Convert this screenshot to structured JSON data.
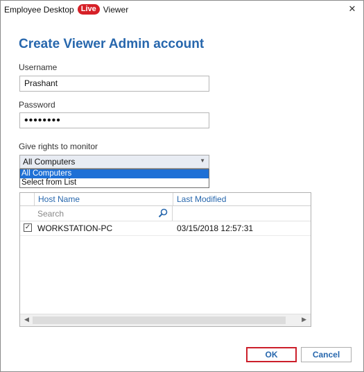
{
  "window": {
    "title_prefix": "Employee Desktop",
    "title_badge": "Live",
    "title_suffix": "Viewer",
    "close_glyph": "✕"
  },
  "form": {
    "heading": "Create Viewer Admin account",
    "username_label": "Username",
    "username_value": "Prashant",
    "password_label": "Password",
    "password_value": "••••••••",
    "rights_label": "Give rights to monitor",
    "rights_selected": "All Computers",
    "rights_options": [
      "All Computers",
      "Select from List"
    ]
  },
  "grid": {
    "columns": [
      "Host Name",
      "Last Modified"
    ],
    "search_placeholder": "Search",
    "rows": [
      {
        "checked": true,
        "host": "WORKSTATION-PC",
        "last_modified": "03/15/2018 12:57:31"
      }
    ]
  },
  "buttons": {
    "ok": "OK",
    "cancel": "Cancel"
  },
  "colors": {
    "accent": "#2767ad",
    "badge": "#d62027",
    "ok_highlight": "#cc1f2a",
    "dropdown_selected": "#1e70d6"
  },
  "icons": [
    "close-icon",
    "chevron-down-icon",
    "search-icon",
    "check-icon",
    "arrow-left-icon",
    "arrow-right-icon"
  ]
}
